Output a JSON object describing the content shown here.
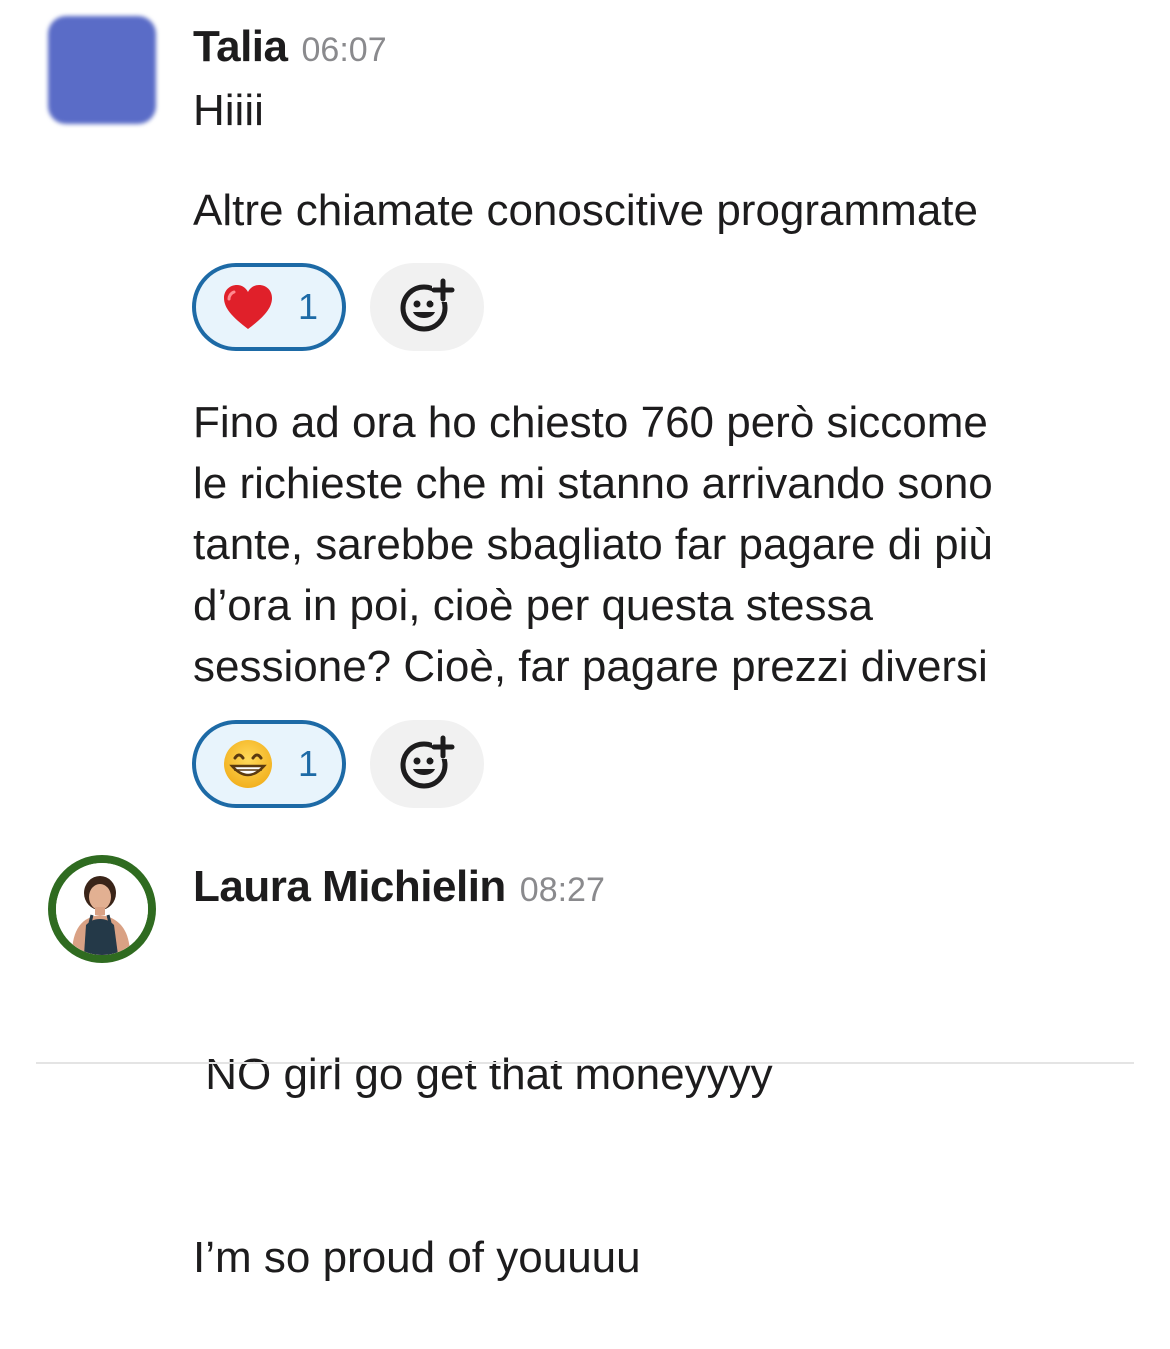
{
  "messages": [
    {
      "author": "Talia",
      "time": "06:07",
      "paragraphs": {
        "p1": "Hiiii",
        "p2": "Altre chiamate conoscitive programmate",
        "p3_lines": [
          "Fino ad ora ho chiesto 760 però siccome",
          "le richieste che mi stanno arrivando sono",
          "tante, sarebbe sbagliato far pagare di più",
          "d’ora in poi, cioè per questa stessa",
          "sessione? Cioè, far pagare prezzi diversi"
        ]
      },
      "reactions": [
        {
          "emoji_name": "red-heart",
          "count": "1"
        },
        {
          "emoji_name": "grinning-face",
          "count": "1"
        }
      ]
    },
    {
      "author": "Laura Michielin",
      "time": "08:27",
      "lines": [
        " NO girl go get that moneyyyy",
        "I’m so proud of youuuu"
      ]
    }
  ],
  "colors": {
    "reaction_border": "#1d6aa6",
    "reaction_bg": "#e8f4fc",
    "avatar_talia": "#5a6cc7",
    "avatar_ring": "#2f6b20"
  },
  "icons": {
    "add_reaction": "add-reaction-icon",
    "heart": "heart-emoji-icon",
    "grin": "grin-emoji-icon"
  }
}
